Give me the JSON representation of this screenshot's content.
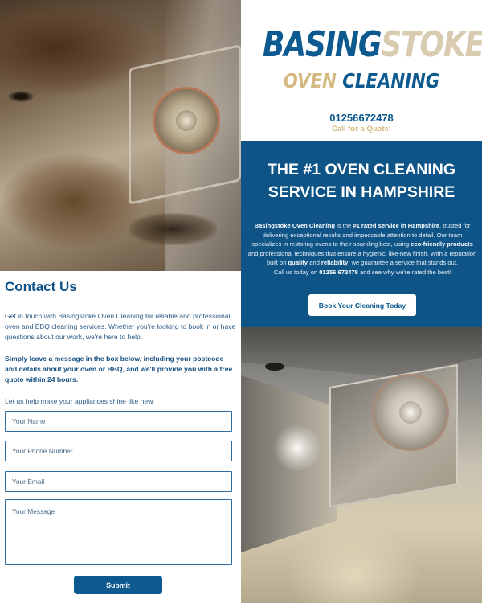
{
  "brand": {
    "name_part1": "BASING",
    "name_part2": "STOKE",
    "sub_part1": "OVEN",
    "sub_part2": "CLEANING",
    "phone": "01256672478",
    "call_cta": "Call for a Quote!",
    "colors": {
      "primary": "#0c5a90",
      "accent": "#d4b982",
      "light_accent": "#d9cbb0"
    }
  },
  "hero": {
    "headline_line1": "THE #1 OVEN CLEANING",
    "headline_line2": "SERVICE IN HAMPSHIRE",
    "p_company": "Basingstoke Oven Cleaning",
    "p_t1": " is the ",
    "p_rated": "#1 rated service in Hampshire",
    "p_t2": ", trusted for delivering exceptional results and impeccable attention to detail. Our team specializes in restoring ovens to their sparkling best, using ",
    "p_eco": "eco-friendly products",
    "p_t3": " and professional techniques that ensure a hygienic, like-new finish. With a reputation built on ",
    "p_quality": "quality",
    "p_and": " and ",
    "p_reliability": "reliability",
    "p_t4": ", we guarantee a service that stands out.",
    "p_call1": "Call us today on ",
    "p_call_phone": "01256 672478",
    "p_call2": " and see why we're rated the best!",
    "book_button": "Book Your Cleaning Today"
  },
  "contact": {
    "title": "Contact Us",
    "intro": "Get in touch with Basingstoke Oven Cleaning for reliable and professional oven and BBQ cleaning services. Whether you're looking to book in or have questions about our work, we're here to help.",
    "instructions": "Simply leave a message in the box below, including your postcode and details about your oven or BBQ, and we'll provide you with a free quote within 24 hours.",
    "closing": "Let us help make your appliances shine like new.",
    "name_placeholder": "Your Name",
    "phone_placeholder": "Your Phone Number",
    "email_placeholder": "Your Email",
    "message_placeholder": "Your Message",
    "submit_label": "Submit"
  }
}
